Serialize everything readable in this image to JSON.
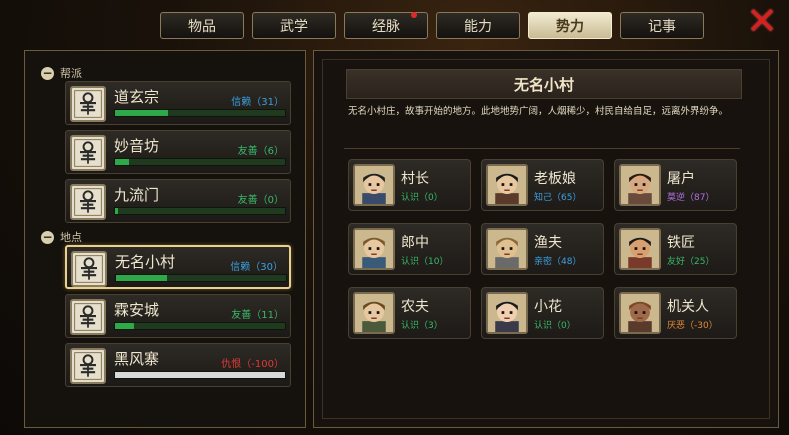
{
  "tabs": [
    {
      "label": "物品",
      "active": false,
      "badge": false
    },
    {
      "label": "武学",
      "active": false,
      "badge": false
    },
    {
      "label": "经脉",
      "active": false,
      "badge": true
    },
    {
      "label": "能力",
      "active": false,
      "badge": false
    },
    {
      "label": "势力",
      "active": true,
      "badge": false
    },
    {
      "label": "记事",
      "active": false,
      "badge": false
    }
  ],
  "close_icon": "close-icon",
  "left": {
    "sections": [
      {
        "title": "帮派",
        "items": [
          {
            "name": "道玄宗",
            "status": "信赖（31）",
            "status_color": "#3aa0e0",
            "progress": 0.31
          },
          {
            "name": "妙音坊",
            "status": "友善（6）",
            "status_color": "#38b868",
            "progress": 0.08
          },
          {
            "name": "九流门",
            "status": "友善（0）",
            "status_color": "#38b868",
            "progress": 0.02
          }
        ]
      },
      {
        "title": "地点",
        "items": [
          {
            "name": "无名小村",
            "status": "信赖（30）",
            "status_color": "#3aa0e0",
            "progress": 0.3,
            "selected": true
          },
          {
            "name": "霖安城",
            "status": "友善（11）",
            "status_color": "#38b868",
            "progress": 0.11
          },
          {
            "name": "黑风寨",
            "status": "仇恨（-100）",
            "status_color": "#e03a3a",
            "progress": 0,
            "hostile": true
          }
        ]
      }
    ]
  },
  "right": {
    "title": "无名小村",
    "description": "无名小村庄，故事开始的地方。此地地势广阔，人烟稀少，村民自给自足，远离外界纷争。",
    "npcs": [
      {
        "name": "村长",
        "status": "认识（0）",
        "status_color": "#38b868",
        "icon": "village-chief-portrait"
      },
      {
        "name": "老板娘",
        "status": "知己（65）",
        "status_color": "#3aa0e0",
        "icon": "landlady-portrait"
      },
      {
        "name": "屠户",
        "status": "莫逆（87）",
        "status_color": "#b070e0",
        "icon": "butcher-portrait"
      },
      {
        "name": "郎中",
        "status": "认识（10）",
        "status_color": "#38b868",
        "icon": "doctor-portrait"
      },
      {
        "name": "渔夫",
        "status": "亲密（48）",
        "status_color": "#3aa0e0",
        "icon": "fisherman-portrait"
      },
      {
        "name": "铁匠",
        "status": "友好（25）",
        "status_color": "#38b868",
        "icon": "blacksmith-portrait"
      },
      {
        "name": "农夫",
        "status": "认识（3）",
        "status_color": "#38b868",
        "icon": "farmer-portrait"
      },
      {
        "name": "小花",
        "status": "认识（0）",
        "status_color": "#38b868",
        "icon": "xiaohua-portrait"
      },
      {
        "name": "机关人",
        "status": "厌恶（-30）",
        "status_color": "#e08a3a",
        "icon": "mechanical-man-portrait"
      }
    ]
  }
}
